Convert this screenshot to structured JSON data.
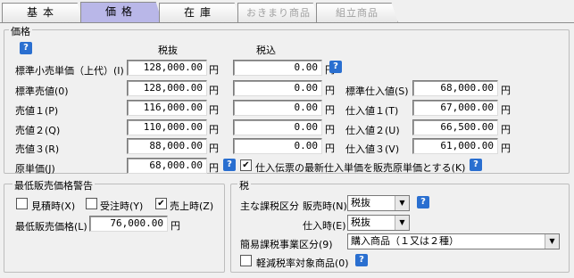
{
  "tabs": [
    {
      "label": "基本",
      "state": "normal"
    },
    {
      "label": "価格",
      "state": "active"
    },
    {
      "label": "在庫",
      "state": "normal"
    },
    {
      "label": "おきまり商品",
      "state": "disabled"
    },
    {
      "label": "組立商品",
      "state": "disabled"
    }
  ],
  "price": {
    "legend": "価格",
    "help": "?",
    "col_excl": "税抜",
    "col_incl": "税込",
    "yen": "円",
    "rows": [
      {
        "label": "標準小売単価（上代）(I)",
        "excl": "128,000.00",
        "incl": "0.00"
      },
      {
        "label": "標準売値(0)",
        "excl": "128,000.00",
        "incl": "0.00"
      },
      {
        "label": "売値１(P)",
        "excl": "116,000.00",
        "incl": "0.00"
      },
      {
        "label": "売値２(Q)",
        "excl": "110,000.00",
        "incl": "0.00"
      },
      {
        "label": "売値３(R)",
        "excl": "88,000.00",
        "incl": "0.00"
      },
      {
        "label": "原単価(J)",
        "excl": "68,000.00"
      }
    ],
    "purchase": [
      {
        "label": "標準仕入値(S)",
        "value": "68,000.00"
      },
      {
        "label": "仕入値１(T)",
        "value": "67,000.00"
      },
      {
        "label": "仕入値２(U)",
        "value": "66,500.00"
      },
      {
        "label": "仕入値３(V)",
        "value": "61,000.00"
      }
    ],
    "latest_cost_checkbox": {
      "label": "仕入伝票の最新仕入単価を販売原単価とする(K)",
      "checked": true
    }
  },
  "min_price": {
    "legend": "最低販売価格警告",
    "estimate": {
      "label": "見積時(X)",
      "checked": false
    },
    "order": {
      "label": "受注時(Y)",
      "checked": false
    },
    "sale": {
      "label": "売上時(Z)",
      "checked": true
    },
    "min_label": "最低販売価格(L)",
    "min_value": "76,000.00",
    "yen": "円"
  },
  "tax": {
    "legend": "税",
    "main_label": "主な課税区分",
    "sales_label": "販売時(N)",
    "sales_value": "税抜",
    "purchase_label": "仕入時(E)",
    "purchase_value": "税抜",
    "simple_label": "簡易課税事業区分(9)",
    "simple_value": "購入商品（１又は２種）",
    "reduced": {
      "label": "軽減税率対象商品(0)",
      "checked": false
    },
    "help": "?"
  }
}
